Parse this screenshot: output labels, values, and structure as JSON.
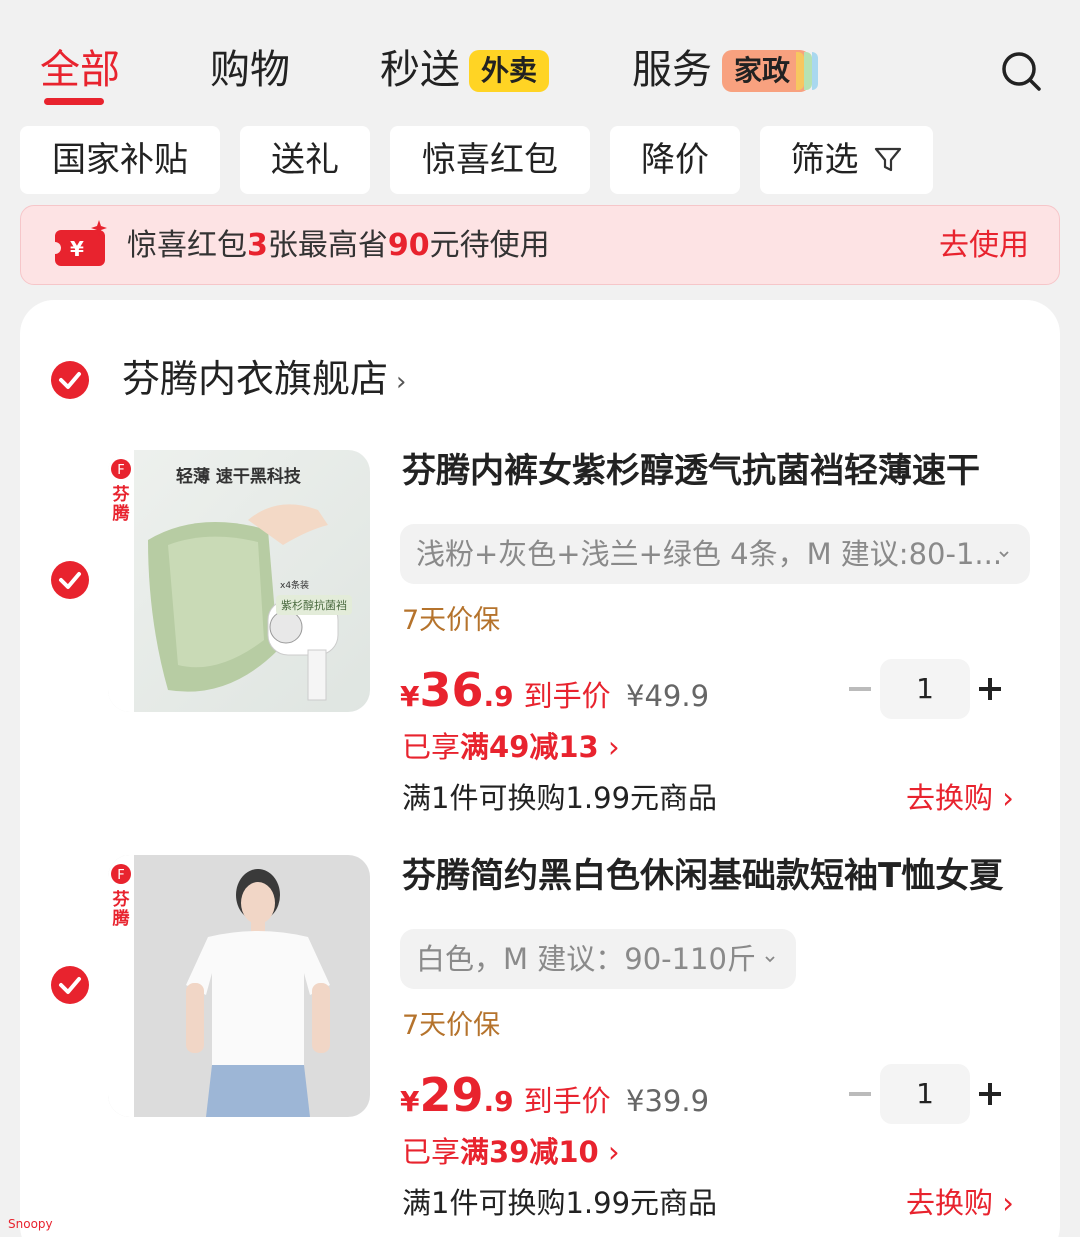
{
  "tabs": [
    {
      "label": "全部",
      "active": true
    },
    {
      "label": "购物"
    },
    {
      "label": "秒送",
      "badge": "外卖"
    },
    {
      "label": "服务",
      "badge": "家政"
    }
  ],
  "filters": [
    "国家补贴",
    "送礼",
    "惊喜红包",
    "降价",
    "筛选"
  ],
  "coupon": {
    "part1": "惊喜红包",
    "count": "3",
    "part2": "张最高省",
    "amount": "90",
    "part3": "元待使用",
    "action": "去使用"
  },
  "store": {
    "name": "芬腾内衣旗舰店",
    "arrow": "›"
  },
  "products": [
    {
      "brand": "芬腾",
      "title": "芬腾内裤女紫杉醇透气抗菌裆轻薄速干",
      "sku": "浅粉+灰色+浅兰+绿色 4条，M 建议:80-1...",
      "guarantee": "7天价保",
      "price_currency": "¥",
      "price_int": "36",
      "price_dec": ".9",
      "price_label": "到手价",
      "original_price": "¥49.9",
      "quantity": "1",
      "promo_prefix": "已享",
      "promo": "满49减13",
      "promo_arrow": "›",
      "exchange": "满1件可换购1.99元商品",
      "exchange_action": "去换购 ›",
      "image_text": {
        "headline": "轻薄 速干黑科技",
        "tag": "紫杉醇抗菌裆",
        "count": "x4条装"
      }
    },
    {
      "brand": "芬腾",
      "title": "芬腾简约黑白色休闲基础款短袖T恤女夏",
      "sku": "白色，M 建议：90-110斤",
      "guarantee": "7天价保",
      "price_currency": "¥",
      "price_int": "29",
      "price_dec": ".9",
      "price_label": "到手价",
      "original_price": "¥39.9",
      "quantity": "1",
      "promo_prefix": "已享",
      "promo": "满39减10",
      "promo_arrow": "›",
      "exchange": "满1件可换购1.99元商品",
      "exchange_action": "去换购 ›"
    }
  ],
  "watermark": "Snoopy",
  "colors": {
    "accent": "#e8232e",
    "background": "#f1f1f1",
    "coupon_bg": "#fde3e4",
    "guarantee": "#b5732c"
  }
}
